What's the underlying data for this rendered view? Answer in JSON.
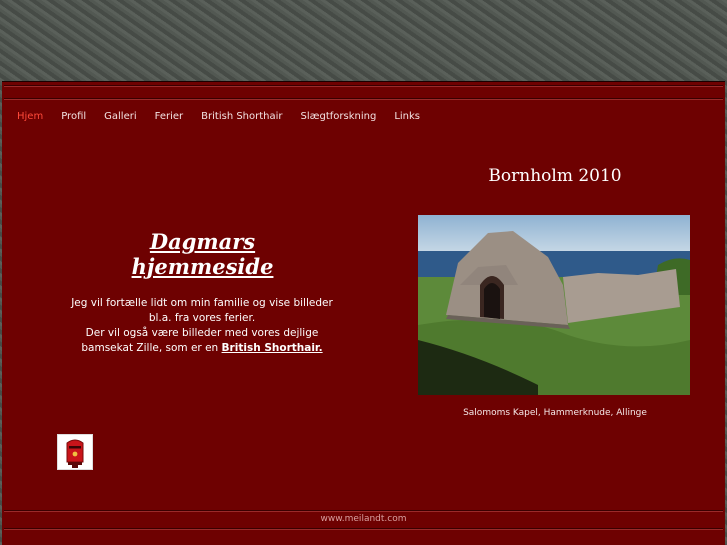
{
  "nav": {
    "items": [
      {
        "label": "Hjem",
        "active": true
      },
      {
        "label": "Profil"
      },
      {
        "label": "Galleri"
      },
      {
        "label": "Ferier"
      },
      {
        "label": "British Shorthair"
      },
      {
        "label": "Slægtforskning"
      },
      {
        "label": "Links"
      }
    ]
  },
  "main": {
    "title": "Dagmars hjemmeside",
    "intro_line1": "Jeg vil fortælle lidt om min familie og vise billeder",
    "intro_line2": "bl.a. fra vores ferier.",
    "intro_line3": "Der vil også være billeder med vores dejlige",
    "intro_line4_prefix": "bamsekat Zille, som er en",
    "intro_link": "British Shorthair."
  },
  "mailbox_icon": "red-mailbox-icon",
  "photo": {
    "heading": "Bornholm 2010",
    "caption": "Salomoms Kapel, Hammerknude, Allinge"
  },
  "footer": {
    "text": "www.meilandt.com"
  },
  "colors": {
    "frame_bg": "#6e0101",
    "nav_active": "#ff4a3a",
    "page_bg": "#4f544f"
  }
}
